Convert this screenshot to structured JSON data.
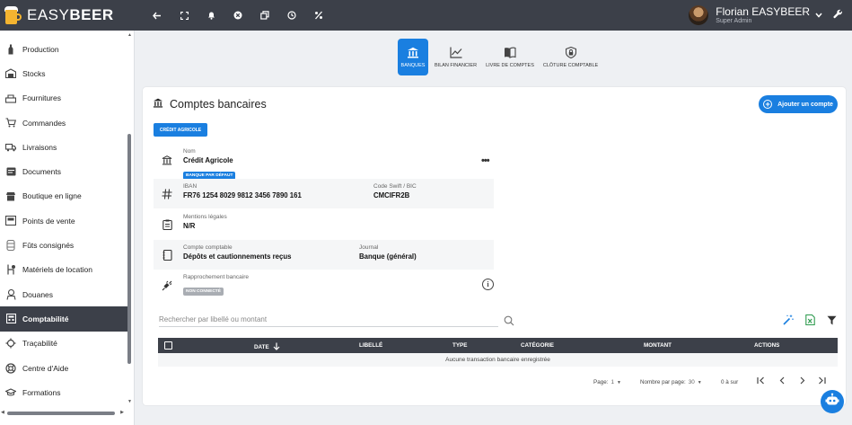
{
  "app": {
    "brand_light": "EASY",
    "brand_bold": "BEER"
  },
  "user": {
    "name": "Florian EASYBEER",
    "role": "Super Admin"
  },
  "sidebar": {
    "items": [
      {
        "label": "Production",
        "icon": "bottle-icon"
      },
      {
        "label": "Stocks",
        "icon": "warehouse-icon"
      },
      {
        "label": "Fournitures",
        "icon": "supplies-icon"
      },
      {
        "label": "Commandes",
        "icon": "cart-icon"
      },
      {
        "label": "Livraisons",
        "icon": "truck-icon"
      },
      {
        "label": "Documents",
        "icon": "document-icon"
      },
      {
        "label": "Boutique en ligne",
        "icon": "shop-icon"
      },
      {
        "label": "Points de vente",
        "icon": "store-icon"
      },
      {
        "label": "Fûts consignés",
        "icon": "keg-icon"
      },
      {
        "label": "Matériels de location",
        "icon": "rental-icon"
      },
      {
        "label": "Douanes",
        "icon": "customs-icon"
      },
      {
        "label": "Comptabilité",
        "icon": "accounting-icon",
        "active": true
      },
      {
        "label": "Traçabilité",
        "icon": "traceability-icon"
      },
      {
        "label": "Centre d'Aide",
        "icon": "help-icon"
      },
      {
        "label": "Formations",
        "icon": "graduation-icon"
      }
    ]
  },
  "tabs": [
    {
      "label": "Banques",
      "icon": "bank-icon",
      "active": true
    },
    {
      "label": "Bilan financier",
      "icon": "chart-line-icon"
    },
    {
      "label": "Livre de comptes",
      "icon": "book-icon"
    },
    {
      "label": "Clôture comptable",
      "icon": "lock-shield-icon"
    }
  ],
  "card": {
    "title": "Comptes bancaires",
    "add_button": "Ajouter un compte",
    "bank_chip": "Crédit Agricole"
  },
  "account": {
    "name_label": "Nom",
    "name_value": "Crédit Agricole",
    "default_badge": "Banque par défaut",
    "iban_label": "IBAN",
    "iban_value": "FR76 1254 8029 9812 3456 7890 161",
    "swift_label": "Code Swift / BIC",
    "swift_value": "CMCIFR2B",
    "legal_label": "Mentions légales",
    "legal_value": "N/R",
    "account_label": "Compte comptable",
    "account_value": "Dépôts et cautionnements reçus",
    "journal_label": "Journal",
    "journal_value": "Banque (général)",
    "reconcile_label": "Rapprochement bancaire",
    "reconcile_badge": "Non connecté"
  },
  "search": {
    "placeholder": "Rechercher par libellé ou montant"
  },
  "table": {
    "columns": [
      "Date",
      "Libellé",
      "Type",
      "Catégorie",
      "Montant",
      "Actions"
    ],
    "empty_message": "Aucune transaction bancaire enregistrée"
  },
  "pager": {
    "page_label": "Page:",
    "page_value": "1",
    "per_page_label": "Nombre par page:",
    "per_page_value": "30",
    "range": "0 à sur"
  },
  "colors": {
    "accent": "#1a7fe0",
    "dark": "#3c4049"
  }
}
